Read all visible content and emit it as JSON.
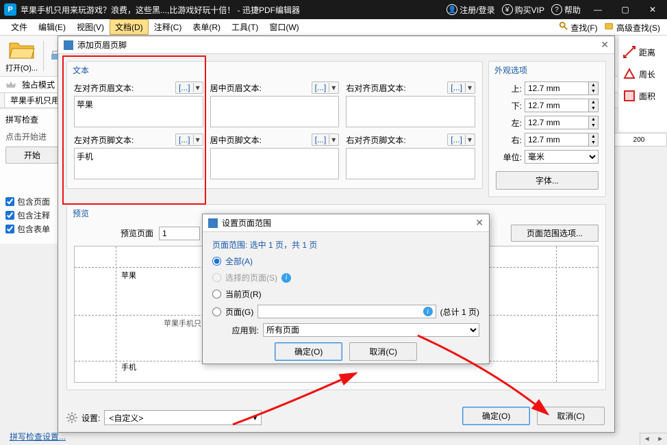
{
  "titlebar": {
    "app_icon": "P",
    "title": "苹果手机只用来玩游戏？浪费，这些黑...,比游戏好玩十倍！ - 迅捷PDF编辑器",
    "login": "注册/登录",
    "vip": "购买VIP",
    "help": "帮助"
  },
  "menubar": {
    "items": [
      "文件",
      "编辑(E)",
      "视图(V)",
      "文档(D)",
      "注释(C)",
      "表单(R)",
      "工具(T)",
      "窗口(W)"
    ],
    "active_index": 3,
    "find": "查找(F)",
    "adv_find": "高级查找(S)"
  },
  "toolbar": {
    "open": "打开(O)...",
    "monopoly": "独占模式"
  },
  "right_tools": {
    "distance": "距离",
    "perimeter": "周长",
    "area": "面积"
  },
  "doc_tab": "苹果手机只用",
  "spell": {
    "title": "拼写检查",
    "hint": "点击开始进",
    "start": "开始",
    "c1": "包含页面",
    "c2": "包含注释",
    "c3": "包含表单",
    "link": "拼写检查设置..."
  },
  "ruler_val": "200",
  "dialog1": {
    "title": "添加页眉页脚",
    "text_group": "文本",
    "labels": {
      "hl": "左对齐页眉文本:",
      "hc": "居中页眉文本:",
      "hr": "右对齐页眉文本:",
      "fl": "左对齐页脚文本:",
      "fc": "居中页脚文本:",
      "fr": "右对齐页脚文本:"
    },
    "macro": "[...]",
    "values": {
      "hl": "苹果",
      "fl": "手机"
    },
    "appear": {
      "title": "外观选项",
      "top": "上:",
      "bottom": "下:",
      "left": "左:",
      "right": "右:",
      "val": "12.7 mm",
      "unit_lbl": "单位:",
      "unit_val": "毫米",
      "font": "字体..."
    },
    "preview": {
      "title": "预览",
      "page_lbl": "预览页面",
      "page_val": "1",
      "range_btn": "页面范围选项...",
      "hl_txt": "苹果",
      "mid_txt": "苹果手机只",
      "fl_txt": "手机"
    },
    "settings_lbl": "设置:",
    "settings_val": "<自定义>",
    "ok": "确定(O)",
    "cancel": "取消(C)"
  },
  "dialog2": {
    "title": "设置页面范围",
    "header": "页面范围: 选中 1 页，共 1 页",
    "all": "全部(A)",
    "selected": "选择的页面(S)",
    "current": "当前页(R)",
    "pages": "页面(G)",
    "total": "(总计 1 页)",
    "apply_lbl": "应用到:",
    "apply_val": "所有页面",
    "ok": "确定(O)",
    "cancel": "取消(C)"
  }
}
